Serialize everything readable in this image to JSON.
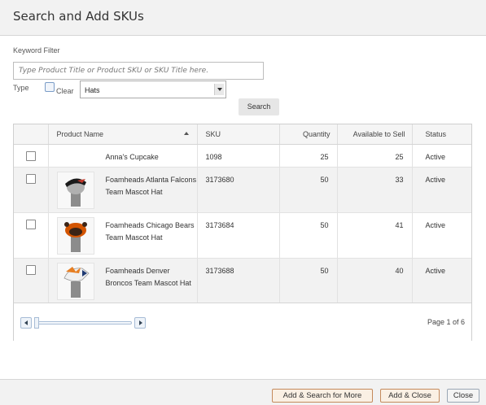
{
  "dialog": {
    "title": "Search and Add SKUs"
  },
  "filter": {
    "keyword_label": "Keyword Filter",
    "keyword_placeholder": "Type Product Title or Product SKU or SKU Title here.",
    "type_label": "Type",
    "clear_label": "Clear",
    "type_value": "Hats",
    "search_button": "Search"
  },
  "grid": {
    "columns": [
      "Product Name",
      "SKU",
      "Quantity",
      "Available to Sell",
      "Status"
    ],
    "rows": [
      {
        "name": "Anna's Cupcake",
        "sku": "1098",
        "quantity": "25",
        "available": "25",
        "status": "Active"
      },
      {
        "name": "Foamheads Atlanta Falcons Team Mascot Hat",
        "sku": "3173680",
        "quantity": "50",
        "available": "33",
        "status": "Active"
      },
      {
        "name": "Foamheads Chicago Bears Team Mascot Hat",
        "sku": "3173684",
        "quantity": "50",
        "available": "41",
        "status": "Active"
      },
      {
        "name": "Foamheads Denver Broncos Team Mascot Hat",
        "sku": "3173688",
        "quantity": "50",
        "available": "40",
        "status": "Active"
      }
    ],
    "page_info": "Page 1 of 6"
  },
  "footer": {
    "add_search_more": "Add & Search for More",
    "add_close": "Add & Close",
    "close": "Close"
  },
  "colors": {
    "header_bg": "#f2f2f2",
    "accent_border": "#c48a5c",
    "alt_row": "#f2f2f2"
  },
  "icons": [
    "checkbox-icon",
    "sort-up-icon",
    "scroll-left-icon",
    "scroll-right-icon",
    "dropdown-arrow-icon"
  ]
}
